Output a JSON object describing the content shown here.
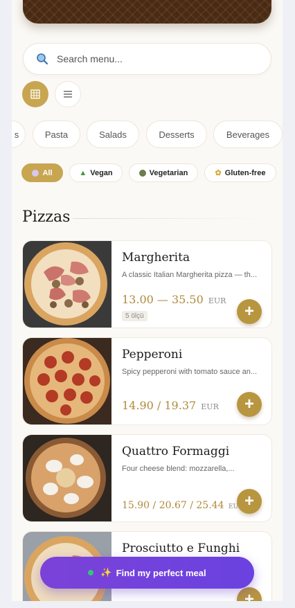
{
  "search": {
    "placeholder": "Search menu..."
  },
  "view": {
    "grid_label": "",
    "list_label": ""
  },
  "categories": [
    "s",
    "Pasta",
    "Salads",
    "Desserts",
    "Beverages"
  ],
  "filters": [
    {
      "label": "All",
      "active": true
    },
    {
      "label": "Vegan",
      "active": false
    },
    {
      "label": "Vegetarian",
      "active": false
    },
    {
      "label": "Gluten-free",
      "active": false
    }
  ],
  "section": {
    "title": "Pizzas"
  },
  "items": [
    {
      "name": "Margherita",
      "description": "A classic Italian Margherita pizza — th...",
      "price": "13.00 — 35.50",
      "currency": "EUR",
      "sizes": "5 ölçü"
    },
    {
      "name": "Pepperoni",
      "description": "Spicy pepperoni with tomato sauce an...",
      "price": "14.90 / 19.37",
      "currency": "EUR"
    },
    {
      "name": "Quattro Formaggi",
      "description": "Four cheese blend: mozzarella,...",
      "price": "15.90 / 20.67 / 25.44",
      "currency": "EUR"
    },
    {
      "name": "Prosciutto e Funghi"
    }
  ],
  "cta": {
    "label": "Find my perfect meal"
  },
  "colors": {
    "accent": "#c8a550",
    "price": "#b08a3c",
    "cta": "#6a42e0"
  }
}
